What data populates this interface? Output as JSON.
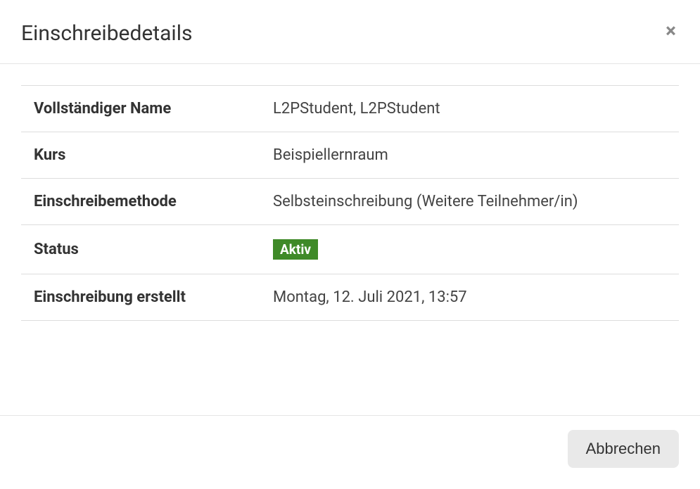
{
  "modal": {
    "title": "Einschreibedetails",
    "fields": {
      "fullname": {
        "label": "Vollständiger Name",
        "value": "L2PStudent, L2PStudent"
      },
      "course": {
        "label": "Kurs",
        "value": "Beispiellernraum"
      },
      "method": {
        "label": "Einschreibemethode",
        "value": "Selbsteinschreibung (Weitere Teilnehmer/in)"
      },
      "status": {
        "label": "Status",
        "value": "Aktiv"
      },
      "created": {
        "label": "Einschreibung erstellt",
        "value": "Montag, 12. Juli 2021, 13:57"
      }
    },
    "cancel_label": "Abbrechen",
    "status_color": "#3f8a28"
  }
}
